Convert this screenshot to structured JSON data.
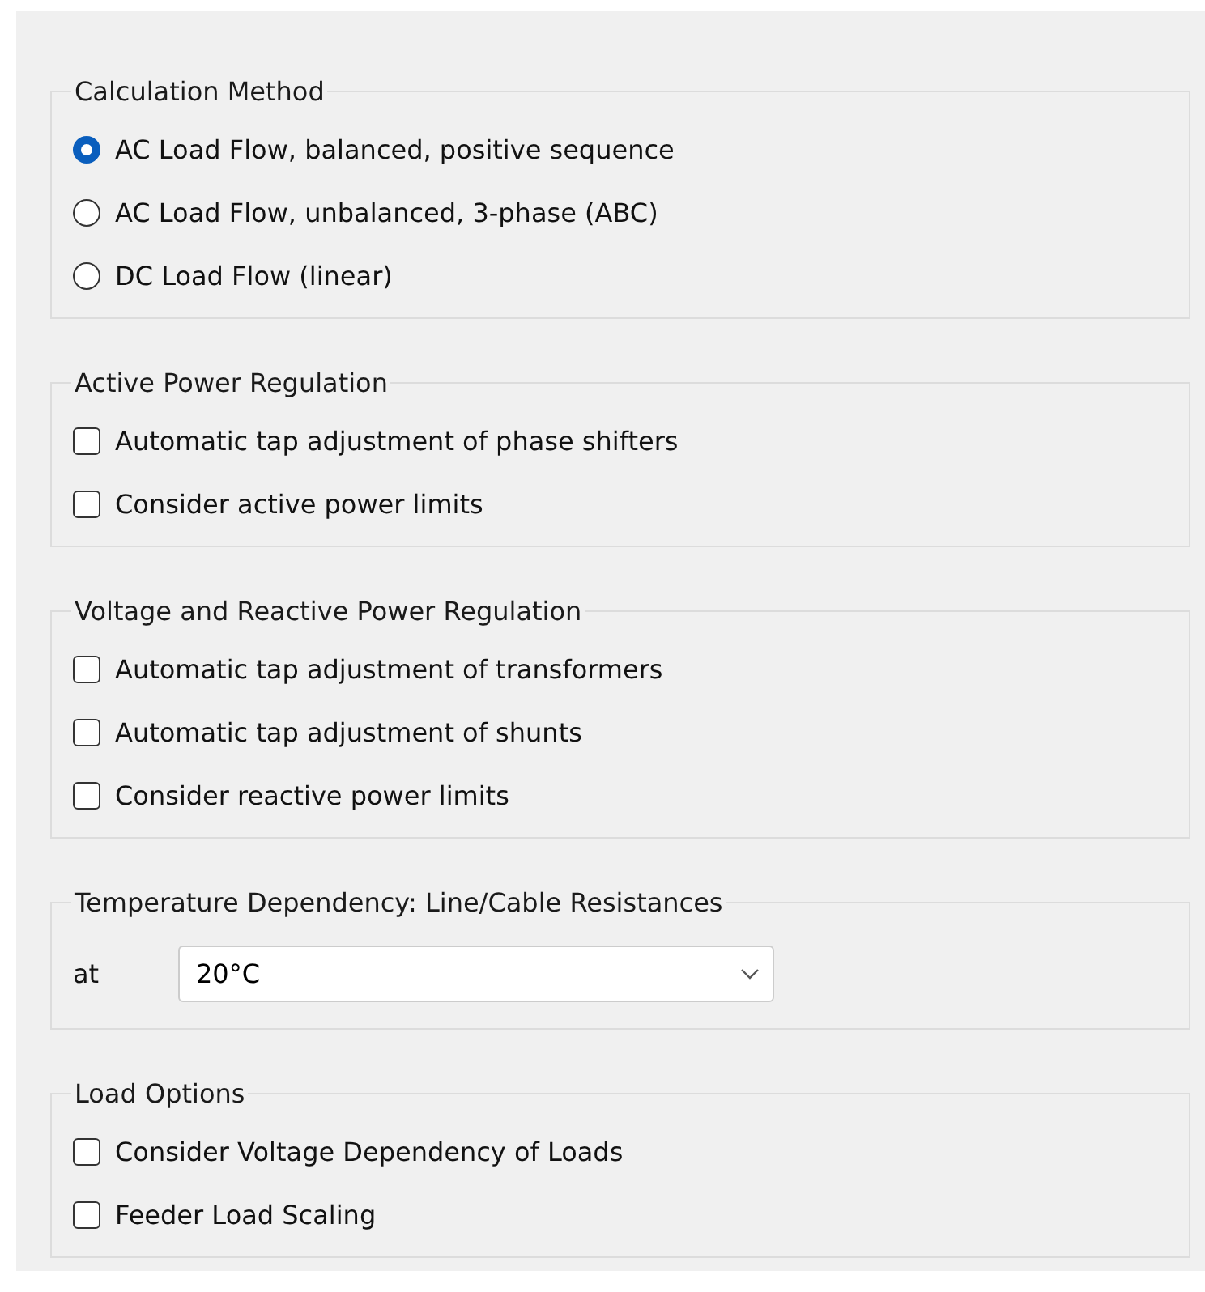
{
  "groups": [
    {
      "title": "Calculation Method",
      "kind": "radio",
      "options": [
        {
          "label": "AC Load Flow, balanced, positive sequence",
          "selected": true
        },
        {
          "label": "AC Load Flow, unbalanced, 3-phase (ABC)",
          "selected": false
        },
        {
          "label": "DC Load Flow (linear)",
          "selected": false
        }
      ]
    },
    {
      "title": "Active Power Regulation",
      "kind": "checkbox",
      "options": [
        {
          "label": "Automatic tap adjustment of phase shifters",
          "checked": false
        },
        {
          "label": "Consider active power limits",
          "checked": false
        }
      ]
    },
    {
      "title": "Voltage and Reactive Power Regulation",
      "kind": "checkbox",
      "options": [
        {
          "label": "Automatic tap adjustment of transformers",
          "checked": false
        },
        {
          "label": "Automatic tap adjustment of shunts",
          "checked": false
        },
        {
          "label": "Consider reactive power limits",
          "checked": false
        }
      ]
    },
    {
      "title": "Temperature Dependency: Line/Cable Resistances",
      "kind": "dropdown",
      "label": "at",
      "value": "20°C"
    },
    {
      "title": "Load Options",
      "kind": "checkbox",
      "options": [
        {
          "label": "Consider Voltage Dependency of Loads",
          "checked": false
        },
        {
          "label": "Feeder Load Scaling",
          "checked": false
        }
      ]
    }
  ]
}
